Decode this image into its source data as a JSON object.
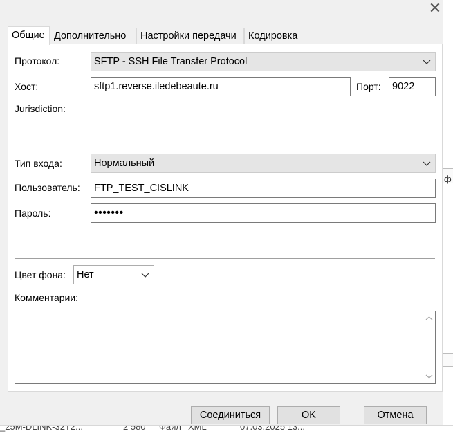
{
  "background": {
    "bottom_row": [
      "_25M-DLINK-32T2...",
      "2 580",
      "Файл",
      "XML",
      "07.03.2025 13..."
    ],
    "right_fragment": "ф"
  },
  "dialog": {
    "close_glyph": "✕"
  },
  "tabs": [
    "Общие",
    "Дополнительно",
    "Настройки передачи",
    "Кодировка"
  ],
  "general": {
    "protocol_label": "Протокол:",
    "protocol_value": "SFTP - SSH File Transfer Protocol",
    "host_label": "Хост:",
    "host_value": "sftp1.reverse.iledebeaute.ru",
    "port_label": "Порт:",
    "port_value": "9022",
    "jurisdiction_label": "Jurisdiction:",
    "logon_type_label": "Тип входа:",
    "logon_type_value": "Нормальный",
    "user_label": "Пользователь:",
    "user_value": "FTP_TEST_CISLINK",
    "password_label": "Пароль:",
    "password_mask": "•••••••",
    "bg_color_label": "Цвет фона:",
    "bg_color_value": "Нет",
    "comments_label": "Комментарии:"
  },
  "buttons": {
    "connect": "Соединиться",
    "ok": "OK",
    "cancel": "Отмена"
  }
}
